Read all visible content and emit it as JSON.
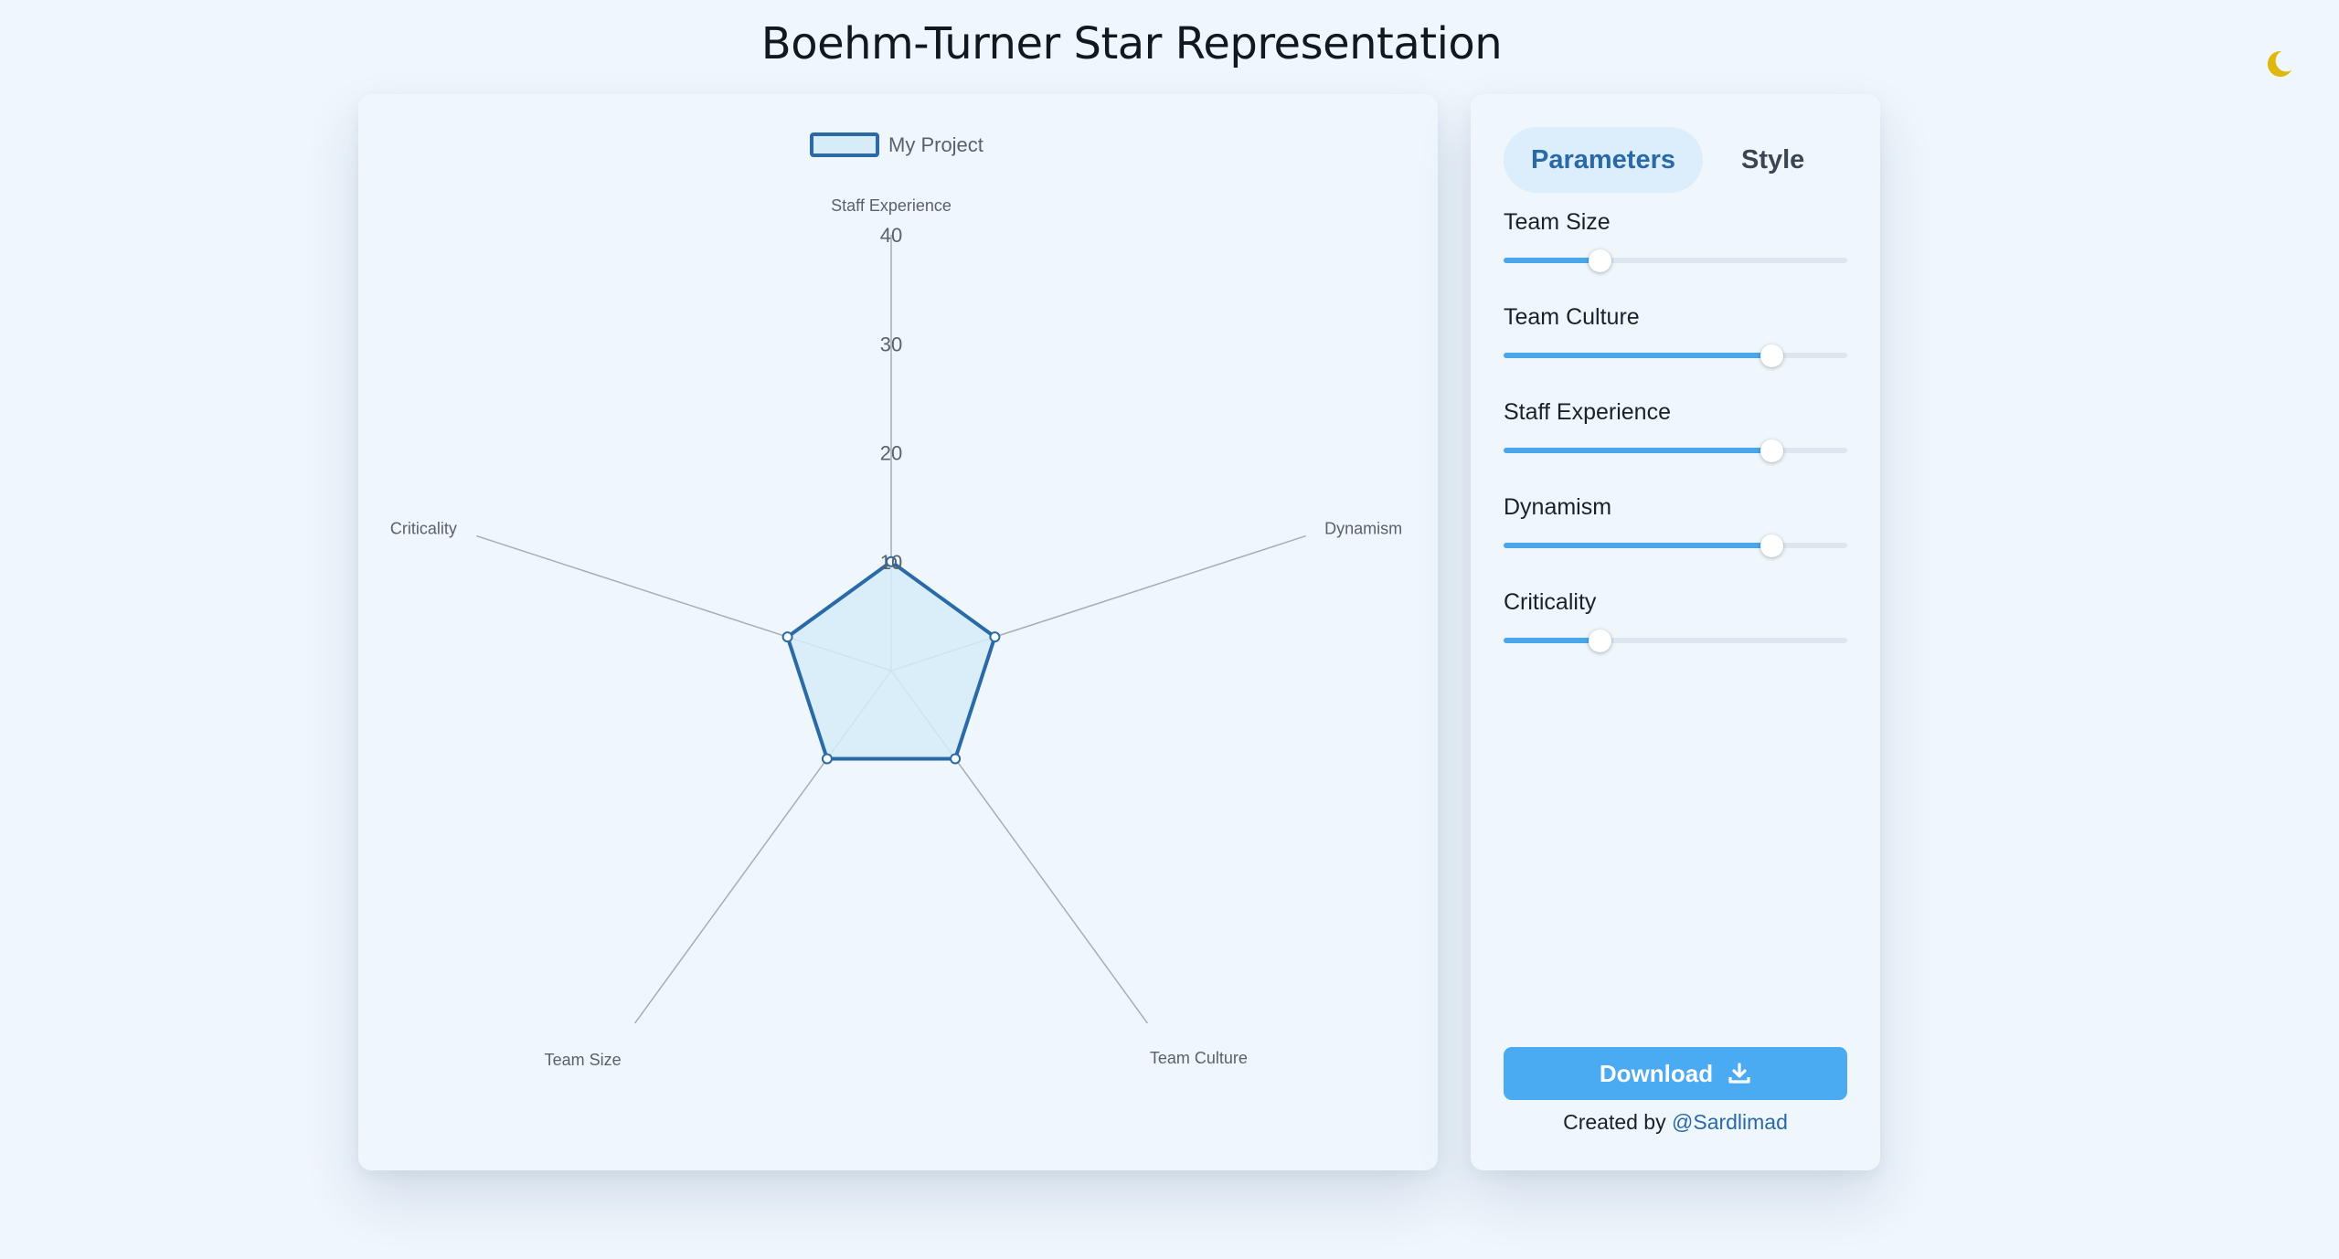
{
  "header": {
    "title": "Boehm-Turner Star Representation",
    "theme_icon": "moon-icon",
    "theme_color": "#e0b80c"
  },
  "tabs": [
    {
      "label": "Parameters",
      "active": true
    },
    {
      "label": "Style",
      "active": false
    }
  ],
  "parameters": [
    {
      "label": "Team Size",
      "value": 0.28
    },
    {
      "label": "Team Culture",
      "value": 0.78
    },
    {
      "label": "Staff Experience",
      "value": 0.78
    },
    {
      "label": "Dynamism",
      "value": 0.78
    },
    {
      "label": "Criticality",
      "value": 0.28
    }
  ],
  "download": {
    "label": "Download",
    "icon": "download-icon"
  },
  "credit": {
    "prefix": "Created by ",
    "handle": "@Sardlimad"
  },
  "colors": {
    "accent": "#4aa6ea",
    "series_stroke": "#2a6aa6",
    "series_fill": "#d6ecf8",
    "axis_line": "#a6adb4"
  },
  "chart_data": {
    "type": "radar",
    "legend": [
      {
        "name": "My Project"
      }
    ],
    "axes": [
      "Staff Experience",
      "Dynamism",
      "Team Culture",
      "Team Size",
      "Criticality"
    ],
    "scale": {
      "min": 0,
      "max": 40
    },
    "tick_labels": [
      "10",
      "20",
      "30",
      "40"
    ],
    "series": [
      {
        "name": "My Project",
        "values": [
          10,
          10,
          10,
          10,
          10
        ]
      }
    ]
  }
}
